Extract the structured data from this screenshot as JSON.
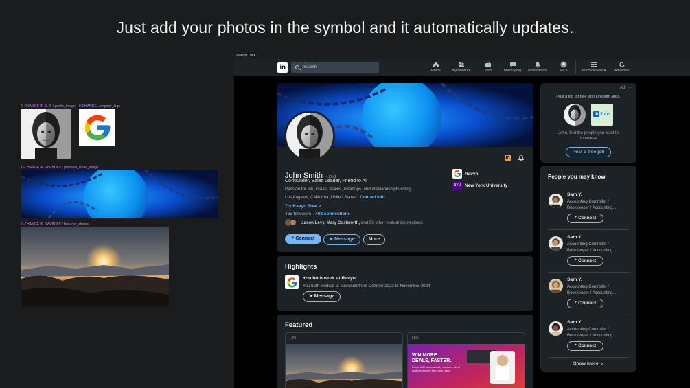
{
  "headline": "Just add your photos in the symbol and it automatically updates.",
  "symbols": {
    "profile_image_label": "0-CHANGE IN S...S / profile_image",
    "company_logo_label": "0-CHANGE...ompany_logo",
    "cover_label": "0-CHANGE IN SYMBOLS / personal_cover_image",
    "featured_label": "0-CHANGE IN SYMBOLS / featured_stories"
  },
  "frame_label": "Desktop Dark",
  "nav": {
    "logo": "in",
    "search_placeholder": "Search",
    "items": [
      {
        "label": "Home",
        "icon": "home-icon",
        "glyph": "⌂"
      },
      {
        "label": "My Network",
        "icon": "network-icon",
        "glyph": "👥"
      },
      {
        "label": "Jobs",
        "icon": "briefcase-icon",
        "glyph": "💼"
      },
      {
        "label": "Messaging",
        "icon": "message-icon",
        "glyph": "💬"
      },
      {
        "label": "Notifications",
        "icon": "bell-icon",
        "glyph": "🔔"
      },
      {
        "label": "Me ▾",
        "icon": "me-avatar",
        "glyph": "●"
      },
      {
        "label": "For Business ▾",
        "icon": "grid-icon",
        "glyph": "⋮⋮"
      },
      {
        "label": "Advertise",
        "icon": "advertise-icon",
        "glyph": "↻"
      }
    ]
  },
  "profile": {
    "name": "John Smith",
    "degree": "· 2nd",
    "headline": "Co-founder, Sales Leader, Friend to All",
    "passions": "Passion for #ai, #saas, #sales, #startups, and #relationshipbuilding",
    "location": "Los Angeles, California, United States ·",
    "contact_info": "Contact info",
    "try_link": "Try Ravyn Free",
    "followers": "465 followers ·",
    "connections": "468 connections",
    "mutual_names": "Jason Levy, Mary Costworth,",
    "mutual_rest": "and 95 other mutual connections",
    "company": "Ravyn",
    "school": "New York University",
    "connect_label": "Connect",
    "message_label": "Message",
    "more_label": "More"
  },
  "highlights": {
    "title": "Highlights",
    "item_title": "You both work at Ravyn",
    "item_desc": "You both worked at Microsoft from October 2023 to November 2024",
    "message_label": "Message"
  },
  "featured": {
    "title": "Featured",
    "items": [
      {
        "type": "Link"
      },
      {
        "type": "Link",
        "promo_title_1": "WIN MORE",
        "promo_title_2": "DEALS, FASTER.",
        "promo_desc": "Ravyn's AI automatically captures client insights directly from your notes."
      }
    ]
  },
  "ad": {
    "label": "Ad",
    "menu": "···",
    "text": "Post a job for free with LinkedIn Jobs.",
    "jobs_logo_in": "in",
    "jobs_logo_text": "Jobs",
    "sub": "John, find the people you want to interview",
    "button": "Post a free job"
  },
  "pymk": {
    "title": "People you may know",
    "people": [
      {
        "name": "Sam Y.",
        "title": "Accounting Controller / Bookkeeper / Accounting...",
        "button": "Connect"
      },
      {
        "name": "Sam Y.",
        "title": "Accounting Controller / Bookkeeper / Accounting...",
        "button": "Connect"
      },
      {
        "name": "Sam Y.",
        "title": "Accounting Controller / Bookkeeper / Accounting...",
        "button": "Connect"
      },
      {
        "name": "Sam Y.",
        "title": "Accounting Controller / Bookkeeper / Accounting...",
        "button": "Connect"
      }
    ],
    "show_more": "Show more"
  },
  "colors": {
    "accent": "#71b7fb",
    "card": "#1d2226",
    "page": "#000000",
    "nav": "#1d2226"
  }
}
